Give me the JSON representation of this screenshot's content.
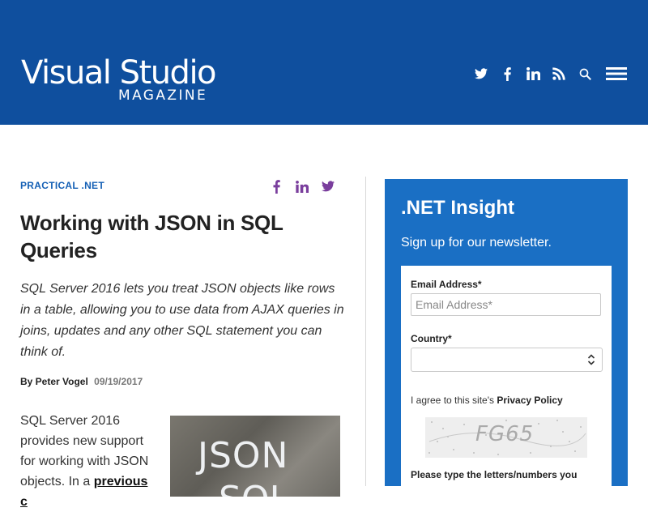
{
  "header": {
    "logo_main": "Visual Studio",
    "logo_sub": "MAGAZINE",
    "icons": [
      "twitter-icon",
      "facebook-icon",
      "linkedin-icon",
      "rss-icon",
      "search-icon",
      "menu-icon"
    ],
    "background": "#0f4f9e"
  },
  "article": {
    "category": "PRACTICAL .NET",
    "title": "Working with JSON in SQL Queries",
    "summary": "SQL Server 2016 lets you treat JSON objects like rows in a table, allowing you to use data from AJAX queries in joins, updates and any other SQL statement you can think of.",
    "byline": "By Peter Vogel",
    "date": "09/19/2017",
    "body_start": "SQL Server 2016 provides new support for working with JSON objects. In a",
    "body_link": "previous c",
    "image_text": "JSON",
    "image_text2": "SQL",
    "share_icons": [
      "facebook-icon",
      "linkedin-icon",
      "twitter-icon"
    ],
    "share_color": "#7a3e9d",
    "accent": "#1560b5"
  },
  "newsletter": {
    "title": ".NET Insight",
    "subtitle": "Sign up for our newsletter.",
    "email_label": "Email Address*",
    "email_placeholder": "Email Address*",
    "country_label": "Country*",
    "country_value": "",
    "agree_text": "I agree to this site's ",
    "agree_link": "Privacy Policy",
    "captcha_text": "FG65",
    "prompt": "Please type the letters/numbers you",
    "background": "#1a6fc4"
  }
}
